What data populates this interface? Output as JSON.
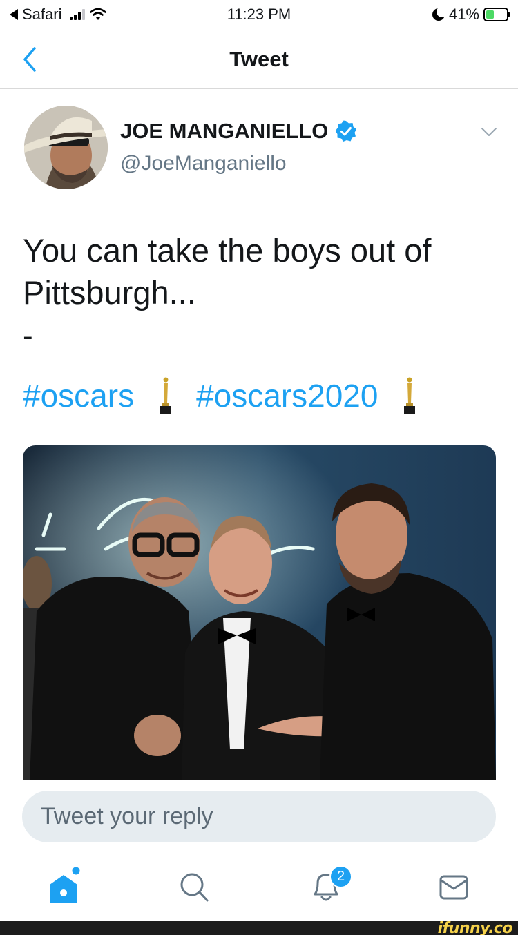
{
  "status_bar": {
    "back_app": "Safari",
    "time": "11:23 PM",
    "battery": "41%",
    "battery_level": 0.41
  },
  "nav": {
    "title": "Tweet",
    "back_icon": "chevron-left-icon"
  },
  "tweet": {
    "author_name": "JOE MANGANIELLO",
    "author_handle": "@JoeManganiello",
    "verified": true,
    "text": "You can take the boys out of Pittsburgh...",
    "separator": "-",
    "hashtags": [
      "#oscars",
      "#oscars2020"
    ],
    "emoji_icon": "oscar-statuette-icon"
  },
  "reply": {
    "placeholder": "Tweet your reply"
  },
  "tabbar": {
    "items": [
      "home-icon",
      "search-icon",
      "notifications-icon",
      "messages-icon"
    ],
    "notification_count": "2"
  },
  "colors": {
    "accent": "#1da1f2",
    "text": "#14171a",
    "secondary": "#657786"
  },
  "watermark": {
    "text": "ifunny.co"
  }
}
